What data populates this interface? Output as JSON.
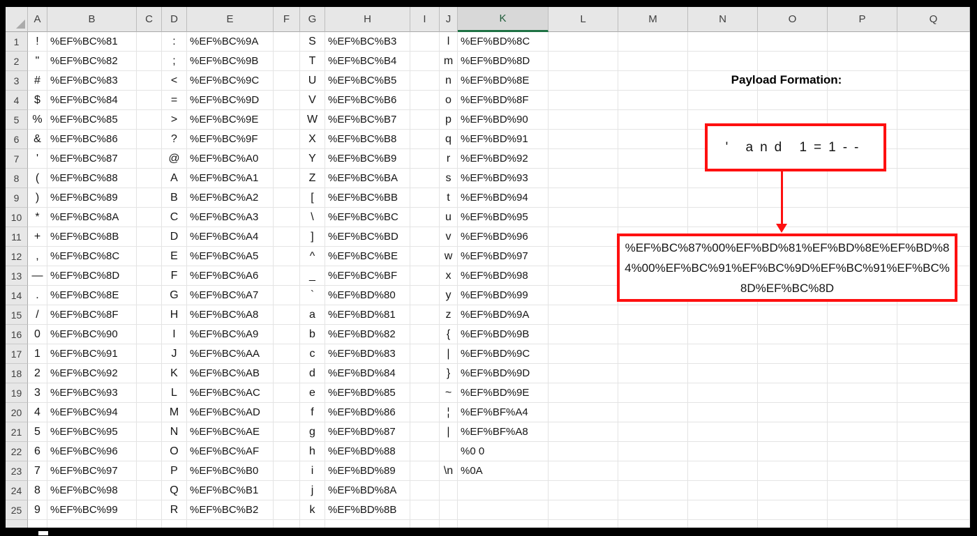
{
  "grid": {
    "columns": [
      "A",
      "B",
      "C",
      "D",
      "E",
      "F",
      "G",
      "H",
      "I",
      "J",
      "K",
      "L",
      "M",
      "N",
      "O",
      "P",
      "Q"
    ],
    "selected_column": "K",
    "char_columns": [
      "A",
      "D",
      "G",
      "J"
    ],
    "code_columns": [
      "B",
      "E",
      "H",
      "K"
    ],
    "rows": [
      {
        "n": "1",
        "cells": {
          "A": "!",
          "B": "%EF%BC%81",
          "D": ":",
          "E": "%EF%BC%9A",
          "G": "S",
          "H": "%EF%BC%B3",
          "J": "l",
          "K": "%EF%BD%8C"
        }
      },
      {
        "n": "2",
        "cells": {
          "A": "\"",
          "B": "%EF%BC%82",
          "D": ";",
          "E": "%EF%BC%9B",
          "G": "T",
          "H": "%EF%BC%B4",
          "J": "m",
          "K": "%EF%BD%8D"
        }
      },
      {
        "n": "3",
        "cells": {
          "A": "#",
          "B": "%EF%BC%83",
          "D": "<",
          "E": "%EF%BC%9C",
          "G": "U",
          "H": "%EF%BC%B5",
          "J": "n",
          "K": "%EF%BD%8E"
        }
      },
      {
        "n": "4",
        "cells": {
          "A": "$",
          "B": "%EF%BC%84",
          "D": "=",
          "E": "%EF%BC%9D",
          "G": "V",
          "H": "%EF%BC%B6",
          "J": "o",
          "K": "%EF%BD%8F"
        }
      },
      {
        "n": "5",
        "cells": {
          "A": "%",
          "B": "%EF%BC%85",
          "D": ">",
          "E": "%EF%BC%9E",
          "G": "W",
          "H": "%EF%BC%B7",
          "J": "p",
          "K": "%EF%BD%90"
        }
      },
      {
        "n": "6",
        "cells": {
          "A": "&",
          "B": "%EF%BC%86",
          "D": "?",
          "E": "%EF%BC%9F",
          "G": "X",
          "H": "%EF%BC%B8",
          "J": "q",
          "K": "%EF%BD%91"
        }
      },
      {
        "n": "7",
        "cells": {
          "A": "'",
          "B": "%EF%BC%87",
          "D": "@",
          "E": "%EF%BC%A0",
          "G": "Y",
          "H": "%EF%BC%B9",
          "J": "r",
          "K": "%EF%BD%92"
        }
      },
      {
        "n": "8",
        "cells": {
          "A": "(",
          "B": "%EF%BC%88",
          "D": "A",
          "E": "%EF%BC%A1",
          "G": "Z",
          "H": "%EF%BC%BA",
          "J": "s",
          "K": "%EF%BD%93"
        }
      },
      {
        "n": "9",
        "cells": {
          "A": ")",
          "B": "%EF%BC%89",
          "D": "B",
          "E": "%EF%BC%A2",
          "G": "[",
          "H": "%EF%BC%BB",
          "J": "t",
          "K": "%EF%BD%94"
        }
      },
      {
        "n": "10",
        "cells": {
          "A": "*",
          "B": "%EF%BC%8A",
          "D": "C",
          "E": "%EF%BC%A3",
          "G": "\\",
          "H": "%EF%BC%BC",
          "J": "u",
          "K": "%EF%BD%95"
        }
      },
      {
        "n": "11",
        "cells": {
          "A": "+",
          "B": "%EF%BC%8B",
          "D": "D",
          "E": "%EF%BC%A4",
          "G": "]",
          "H": "%EF%BC%BD",
          "J": "v",
          "K": "%EF%BD%96"
        }
      },
      {
        "n": "12",
        "cells": {
          "A": ",",
          "B": "%EF%BC%8C",
          "D": "E",
          "E": "%EF%BC%A5",
          "G": "^",
          "H": "%EF%BC%BE",
          "J": "w",
          "K": "%EF%BD%97"
        }
      },
      {
        "n": "13",
        "cells": {
          "A": "—",
          "B": "%EF%BC%8D",
          "D": "F",
          "E": "%EF%BC%A6",
          "G": "_",
          "H": "%EF%BC%BF",
          "J": "x",
          "K": "%EF%BD%98"
        }
      },
      {
        "n": "14",
        "cells": {
          "A": ".",
          "B": "%EF%BC%8E",
          "D": "G",
          "E": "%EF%BC%A7",
          "G": "`",
          "H": "%EF%BD%80",
          "J": "y",
          "K": "%EF%BD%99"
        }
      },
      {
        "n": "15",
        "cells": {
          "A": "/",
          "B": "%EF%BC%8F",
          "D": "H",
          "E": "%EF%BC%A8",
          "G": "a",
          "H": "%EF%BD%81",
          "J": "z",
          "K": "%EF%BD%9A"
        }
      },
      {
        "n": "16",
        "cells": {
          "A": "0",
          "B": "%EF%BC%90",
          "D": "I",
          "E": "%EF%BC%A9",
          "G": "b",
          "H": "%EF%BD%82",
          "J": "{",
          "K": "%EF%BD%9B"
        }
      },
      {
        "n": "17",
        "cells": {
          "A": "1",
          "B": "%EF%BC%91",
          "D": "J",
          "E": "%EF%BC%AA",
          "G": "c",
          "H": "%EF%BD%83",
          "J": "|",
          "K": "%EF%BD%9C"
        }
      },
      {
        "n": "18",
        "cells": {
          "A": "2",
          "B": "%EF%BC%92",
          "D": "K",
          "E": "%EF%BC%AB",
          "G": "d",
          "H": "%EF%BD%84",
          "J": "}",
          "K": "%EF%BD%9D"
        }
      },
      {
        "n": "19",
        "cells": {
          "A": "3",
          "B": "%EF%BC%93",
          "D": "L",
          "E": "%EF%BC%AC",
          "G": "e",
          "H": "%EF%BD%85",
          "J": "~",
          "K": "%EF%BD%9E"
        }
      },
      {
        "n": "20",
        "cells": {
          "A": "4",
          "B": "%EF%BC%94",
          "D": "M",
          "E": "%EF%BC%AD",
          "G": "f",
          "H": "%EF%BD%86",
          "J": "¦",
          "K": "%EF%BF%A4"
        }
      },
      {
        "n": "21",
        "cells": {
          "A": "5",
          "B": "%EF%BC%95",
          "D": "N",
          "E": "%EF%BC%AE",
          "G": "g",
          "H": "%EF%BD%87",
          "J": "|",
          "K": "%EF%BF%A8"
        }
      },
      {
        "n": "22",
        "cells": {
          "A": "6",
          "B": "%EF%BC%96",
          "D": "O",
          "E": "%EF%BC%AF",
          "G": "h",
          "H": "%EF%BD%88",
          "K": "%0 0"
        }
      },
      {
        "n": "23",
        "cells": {
          "A": "7",
          "B": "%EF%BC%97",
          "D": "P",
          "E": "%EF%BC%B0",
          "G": "i",
          "H": "%EF%BD%89",
          "J": "\\n",
          "K": "%0A"
        }
      },
      {
        "n": "24",
        "cells": {
          "A": "8",
          "B": "%EF%BC%98",
          "D": "Q",
          "E": "%EF%BC%B1",
          "G": "j",
          "H": "%EF%BD%8A"
        }
      },
      {
        "n": "25",
        "cells": {
          "A": "9",
          "B": "%EF%BC%99",
          "D": "R",
          "E": "%EF%BC%B2",
          "G": "k",
          "H": "%EF%BD%8B"
        }
      }
    ]
  },
  "annotation": {
    "title": "Payload Formation:",
    "payload_display": "' and 1=1--",
    "encoded_payload": "%EF%BC%87%00%EF%BD%81%EF%BD%8E%EF%BD%84%00%EF%BC%91%EF%BC%9D%EF%BC%91%EF%BC%8D%EF%BC%8D",
    "accent_red": "#FE1010"
  }
}
